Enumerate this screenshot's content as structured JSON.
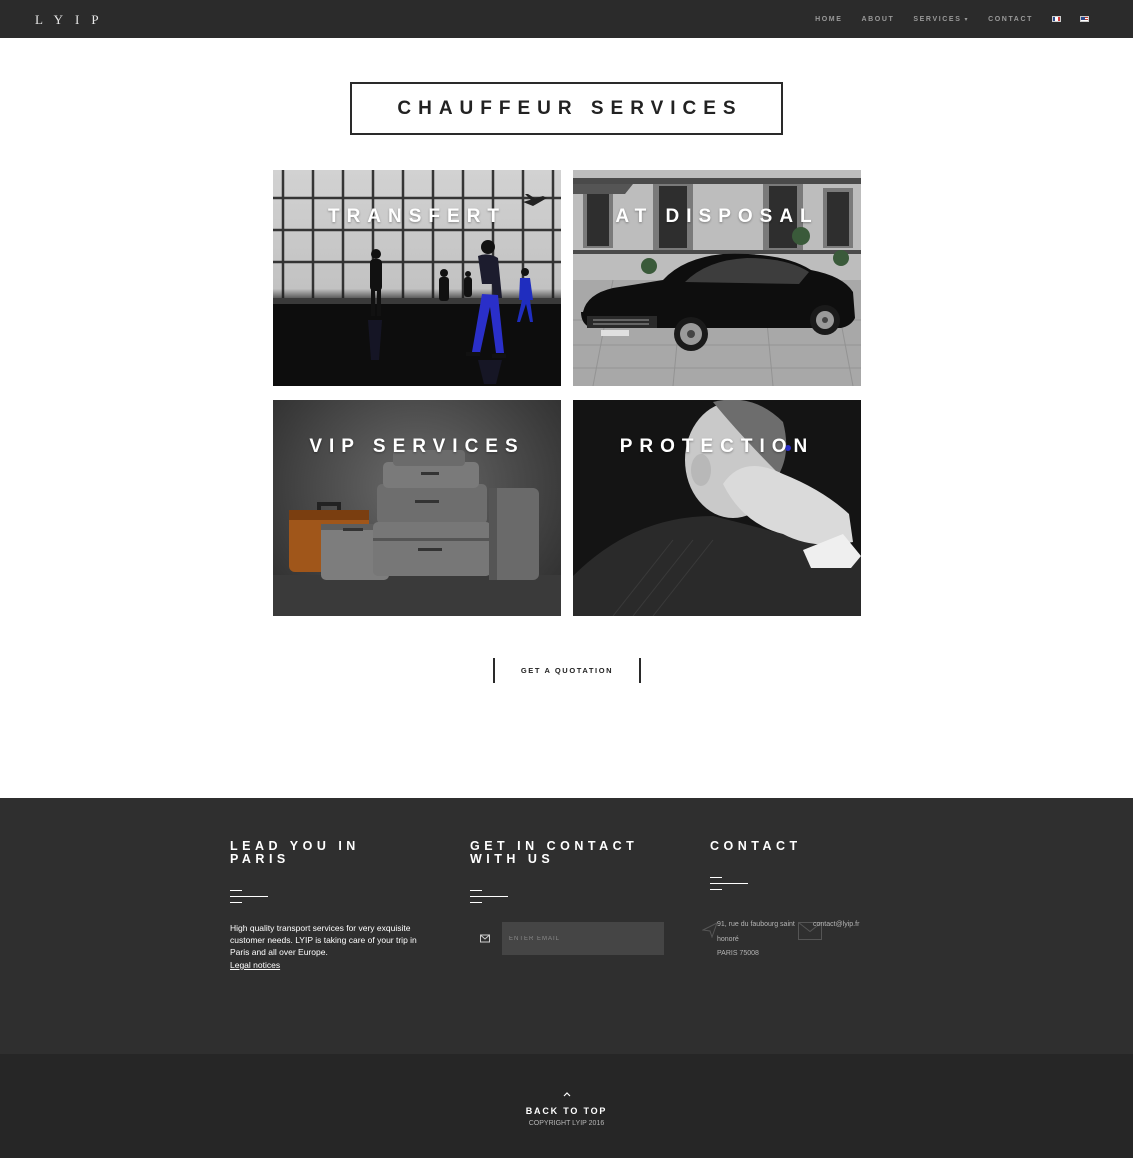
{
  "nav": {
    "logo": "LYIP",
    "items": [
      {
        "label": "HOME"
      },
      {
        "label": "ABOUT"
      },
      {
        "label": "SERVICES"
      },
      {
        "label": "CONTACT"
      }
    ],
    "services_caret": "▾"
  },
  "page_title": "CHAUFFEUR SERVICES",
  "tiles": [
    {
      "label": "TRANSFERT"
    },
    {
      "label": "AT DISPOSAL"
    },
    {
      "label": "VIP SERVICES"
    },
    {
      "label": "PROTECTION"
    }
  ],
  "quote_button": "GET A QUOTATION",
  "footer": {
    "col1": {
      "title_line1": "LEAD YOU IN",
      "title_line2": "PARIS",
      "text": "High quality transport services for very exquisite customer needs. LYIP is taking care of your trip in Paris and all over Europe.",
      "legal": "Legal notices"
    },
    "col2": {
      "title_line1": "GET IN CONTACT",
      "title_line2": "WITH US",
      "email_placeholder": "ENTER EMAIL"
    },
    "col3": {
      "title": "CONTACT",
      "address_line1": "91, rue du faubourg saint",
      "address_line2": "honoré",
      "address_line3": "PARIS 75008",
      "email": "contact@lyip.fr"
    },
    "back_to_top": "BACK TO TOP",
    "copyright": "COPYRIGHT LYIP 2016"
  },
  "colors": {
    "nav_bg": "#2b2b2b",
    "footer_bg": "#2f2f2f",
    "bottom_bg": "#262626",
    "accent_blue": "#2a2fc9"
  }
}
